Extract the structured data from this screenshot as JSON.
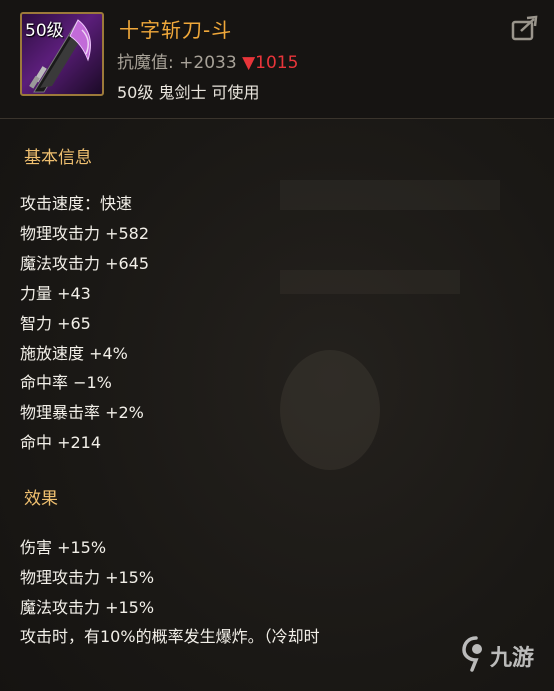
{
  "item": {
    "level_badge": "50级",
    "name": "十字斩刀-斗",
    "stat_label": "抗魔值:",
    "stat_value": "+2033",
    "stat_diff": "▼1015",
    "class_line": "50级 鬼剑士 可使用",
    "icon": "crossblade-sword-icon"
  },
  "basic": {
    "title": "基本信息",
    "attrs": [
      "攻击速度：快速",
      "物理攻击力 +582",
      "魔法攻击力 +645",
      "力量 +43",
      "智力 +65",
      "施放速度 +4%",
      "命中率 −1%",
      "物理暴击率 +2%",
      "命中 +214"
    ]
  },
  "effects": {
    "title": "效果",
    "lines": [
      "伤害 +15%",
      "物理攻击力 +15%",
      "魔法攻击力 +15%",
      "攻击时，有10%的概率发生爆炸。（冷却时"
    ]
  },
  "watermark": {
    "text": "九游",
    "icon": "jiuyou-logo-icon"
  },
  "colors": {
    "item_name": "#f0a83a",
    "section_title": "#f0c070",
    "stat_decrease": "#e8353a",
    "frame": "#9c7a3a"
  }
}
